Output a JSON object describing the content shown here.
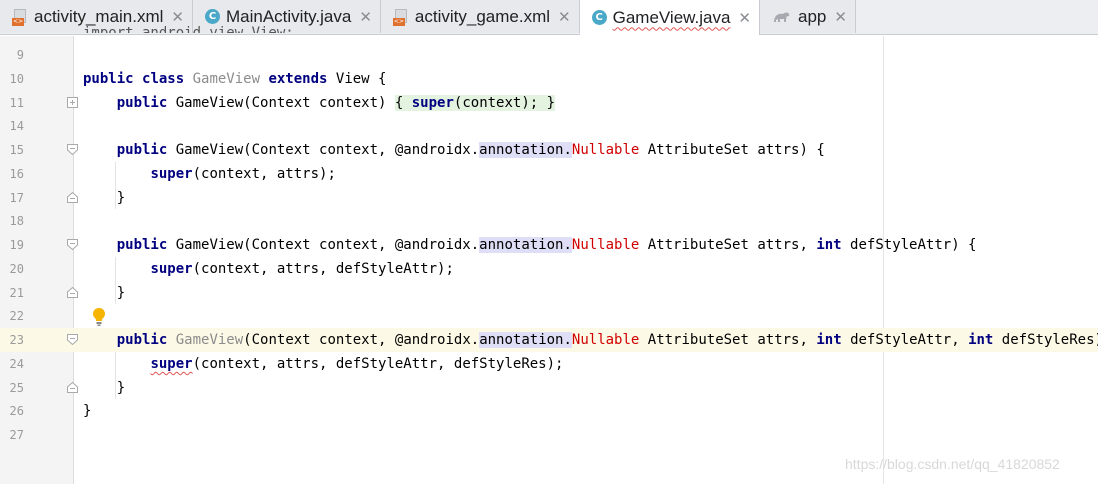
{
  "tabs": [
    {
      "label": "activity_main.xml",
      "icon": "xml-file-icon",
      "active": false
    },
    {
      "label": "MainActivity.java",
      "icon": "java-class-icon",
      "active": false
    },
    {
      "label": "activity_game.xml",
      "icon": "xml-file-icon",
      "active": false
    },
    {
      "label": "GameView.java",
      "icon": "java-class-icon",
      "active": true
    },
    {
      "label": "app",
      "icon": "gradle-icon",
      "active": false
    }
  ],
  "close_glyph": "✕",
  "editor": {
    "cut_line": "import android.view.View;",
    "current_line": 23,
    "lines": [
      {
        "num": "9"
      },
      {
        "num": "10",
        "segments": [
          {
            "t": "public ",
            "c": "kw"
          },
          {
            "t": "class ",
            "c": "kw"
          },
          {
            "t": "GameView ",
            "c": "unused"
          },
          {
            "t": "extends ",
            "c": "kw"
          },
          {
            "t": "View {",
            "c": ""
          }
        ]
      },
      {
        "num": "11",
        "segments": [
          {
            "t": "    ",
            "c": ""
          },
          {
            "t": "public ",
            "c": "kw"
          },
          {
            "t": "GameView(Context context) ",
            "c": ""
          },
          {
            "t": "{ ",
            "c": "foldhl"
          },
          {
            "t": "super",
            "c": "kw foldhl"
          },
          {
            "t": "(context); ",
            "c": "foldhl"
          },
          {
            "t": "}",
            "c": "foldhl"
          }
        ]
      },
      {
        "num": "14"
      },
      {
        "num": "15",
        "segments": [
          {
            "t": "    ",
            "c": ""
          },
          {
            "t": "public ",
            "c": "kw"
          },
          {
            "t": "GameView(Context context, @androidx.",
            "c": ""
          },
          {
            "t": "annotation.",
            "c": "hl"
          },
          {
            "t": "Nullable ",
            "c": "red"
          },
          {
            "t": "AttributeSet attrs) {",
            "c": ""
          }
        ]
      },
      {
        "num": "16",
        "segments": [
          {
            "t": "        ",
            "c": ""
          },
          {
            "t": "super",
            "c": "kw"
          },
          {
            "t": "(context, attrs);",
            "c": ""
          }
        ]
      },
      {
        "num": "17",
        "segments": [
          {
            "t": "    }",
            "c": ""
          }
        ]
      },
      {
        "num": "18"
      },
      {
        "num": "19",
        "segments": [
          {
            "t": "    ",
            "c": ""
          },
          {
            "t": "public ",
            "c": "kw"
          },
          {
            "t": "GameView(Context context, @androidx.",
            "c": ""
          },
          {
            "t": "annotation.",
            "c": "hl"
          },
          {
            "t": "Nullable ",
            "c": "red"
          },
          {
            "t": "AttributeSet attrs, ",
            "c": ""
          },
          {
            "t": "int ",
            "c": "kw"
          },
          {
            "t": "defStyleAttr) {",
            "c": ""
          }
        ]
      },
      {
        "num": "20",
        "segments": [
          {
            "t": "        ",
            "c": ""
          },
          {
            "t": "super",
            "c": "kw"
          },
          {
            "t": "(context, attrs, defStyleAttr);",
            "c": ""
          }
        ]
      },
      {
        "num": "21",
        "segments": [
          {
            "t": "    }",
            "c": ""
          }
        ]
      },
      {
        "num": "22"
      },
      {
        "num": "23",
        "segments": [
          {
            "t": "    ",
            "c": ""
          },
          {
            "t": "public ",
            "c": "kw"
          },
          {
            "t": "GameView",
            "c": "unused"
          },
          {
            "t": "(Context context, @androidx.",
            "c": ""
          },
          {
            "t": "annotation.",
            "c": "hl"
          },
          {
            "t": "Nullable ",
            "c": "red"
          },
          {
            "t": "AttributeSet attrs, ",
            "c": ""
          },
          {
            "t": "int ",
            "c": "kw"
          },
          {
            "t": "defStyleAttr, ",
            "c": ""
          },
          {
            "t": "int ",
            "c": "kw"
          },
          {
            "t": "defStyleRes) {",
            "c": ""
          }
        ]
      },
      {
        "num": "24",
        "segments": [
          {
            "t": "        ",
            "c": ""
          },
          {
            "t": "super",
            "c": "kw squig"
          },
          {
            "t": "(context, attrs, defStyleAttr, defStyleRes);",
            "c": ""
          }
        ]
      },
      {
        "num": "25",
        "segments": [
          {
            "t": "    }",
            "c": ""
          }
        ]
      },
      {
        "num": "26",
        "segments": [
          {
            "t": "}",
            "c": ""
          }
        ]
      },
      {
        "num": "27"
      }
    ]
  },
  "watermark": "https://blog.csdn.net/qq_41820852",
  "colors": {
    "keyword": "#000080",
    "unused": "#8c8c8c",
    "error": "#d00000",
    "current_line": "#fcfae6"
  }
}
